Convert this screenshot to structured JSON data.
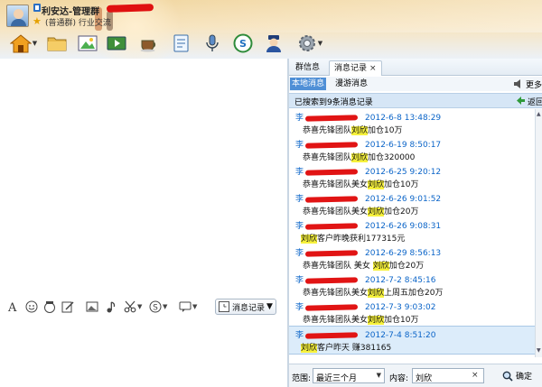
{
  "header": {
    "group_name": "利安达-管理群",
    "group_type": "(普通群) 行业交流"
  },
  "toolbar": {
    "icons": [
      "home-icon",
      "folder-icon",
      "picture-icon",
      "video-icon",
      "coffee-icon",
      "notes-icon",
      "microphone-icon",
      "soso-icon",
      "police-icon",
      "settings-icon"
    ]
  },
  "input_toolbar": {
    "msg_record_label": "消息记录"
  },
  "right_panel": {
    "tabs": [
      {
        "label": "群信息"
      },
      {
        "label": "消息记录",
        "close": "×"
      }
    ],
    "subtabs": [
      {
        "label": "本地消息"
      },
      {
        "label": "漫游消息"
      }
    ],
    "more_label": "更多",
    "search_summary": "已搜索到9条消息记录",
    "back_label": "返回",
    "messages": [
      {
        "sender": "李",
        "time": "2012-6-8 13:48:29",
        "pre": "恭喜先锋团队",
        "hl": "刘欣",
        "post": "加仓10万"
      },
      {
        "sender": "李",
        "time": "2012-6-19 8:50:17",
        "pre": "恭喜先锋团队",
        "hl": "刘欣",
        "post": "加仓320000"
      },
      {
        "sender": "李",
        "time": "2012-6-25 9:20:12",
        "pre": "恭喜先锋团队美女",
        "hl": "刘欣",
        "post": "加仓10万"
      },
      {
        "sender": "李",
        "time": "2012-6-26 9:01:52",
        "pre": "恭喜先锋团队美女",
        "hl": "刘欣",
        "post": "加仓20万"
      },
      {
        "sender": "李",
        "time": "2012-6-26 9:08:31",
        "pre": "",
        "hl": "刘欣",
        "post": "客户昨晚获利177315元"
      },
      {
        "sender": "李",
        "time": "2012-6-29 8:56:13",
        "pre": "恭喜先锋团队  美女 ",
        "hl": "刘欣",
        "post": "加仓20万"
      },
      {
        "sender": "李",
        "time": "2012-7-2 8:45:16",
        "pre": "恭喜先锋团队美女",
        "hl": "刘欣",
        "post": "上周五加仓20万"
      },
      {
        "sender": "李",
        "time": "2012-7-3 9:03:02",
        "pre": "恭喜先锋团队美女",
        "hl": "刘欣",
        "post": "加仓10万"
      },
      {
        "sender": "李",
        "time": "2012-7-4 8:51:20",
        "pre": "",
        "hl": "刘欣",
        "post": "客户昨天  赚381165"
      }
    ],
    "search": {
      "range_label": "范围:",
      "range_value": "最近三个月",
      "content_label": "内容:",
      "content_value": "刘欣",
      "clear": "×",
      "ok_label": "确定"
    }
  }
}
